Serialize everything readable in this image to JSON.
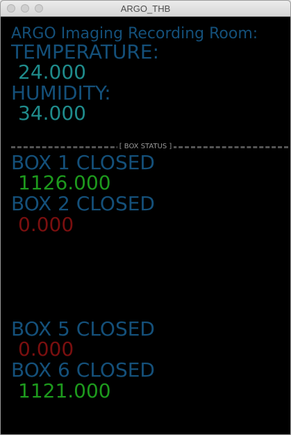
{
  "window": {
    "title": "ARGO_THB"
  },
  "room": {
    "heading": "ARGO Imaging Recording Room:",
    "temperature_label": "TEMPERATURE:",
    "temperature_value": "24.000",
    "humidity_label": "HUMIDITY:",
    "humidity_value": "34.000"
  },
  "divider": {
    "label": "[ BOX  STATUS ]"
  },
  "boxes": [
    {
      "label": "BOX 1 CLOSED",
      "value": "1126.000",
      "value_color": "green"
    },
    {
      "label": "BOX 2 CLOSED",
      "value": "0.000",
      "value_color": "red"
    },
    {
      "label": "BOX 5 CLOSED",
      "value": "0.000",
      "value_color": "red"
    },
    {
      "label": "BOX 6 CLOSED",
      "value": "1121.000",
      "value_color": "green"
    }
  ],
  "colors": {
    "label_blue": "#14507a",
    "reading_teal": "#1f8c8c",
    "value_green": "#1d9a1d",
    "value_red": "#7a0f0f",
    "background": "#000000"
  }
}
